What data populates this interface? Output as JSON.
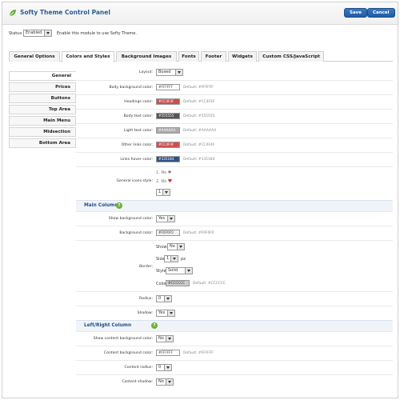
{
  "header": {
    "title": "Softy Theme Control Panel",
    "save_label": "Save",
    "cancel_label": "Cancel"
  },
  "status": {
    "label": "Status:",
    "value": "Enabled",
    "description": "Enable this module to use Softy Theme."
  },
  "tabs": [
    {
      "label": "General Options"
    },
    {
      "label": "Colors and Styles"
    },
    {
      "label": "Background Images"
    },
    {
      "label": "Fonts"
    },
    {
      "label": "Footer"
    },
    {
      "label": "Widgets"
    },
    {
      "label": "Custom CSS/JavaScript"
    }
  ],
  "sidebar": [
    {
      "label": "General"
    },
    {
      "label": "Prices"
    },
    {
      "label": "Buttons"
    },
    {
      "label": "Top Area"
    },
    {
      "label": "Main Menu"
    },
    {
      "label": "Midsection"
    },
    {
      "label": "Bottom Area"
    }
  ],
  "general": {
    "layout": {
      "label": "Layout:",
      "value": "Boxed"
    },
    "colors": [
      {
        "label": "Body background color:",
        "value": "#FFFFFF",
        "default": "Default: #FFFFFF",
        "swatch": "#FFFFFF"
      },
      {
        "label": "Headings color:",
        "value": "#CC4F4F",
        "default": "Default: #CC4F4F",
        "swatch": "#CC4F4F"
      },
      {
        "label": "Body text color:",
        "value": "#555555",
        "default": "Default: #555555",
        "swatch": "#555555"
      },
      {
        "label": "Light text color:",
        "value": "#AAAAAA",
        "default": "Default: #AAAAAA",
        "swatch": "#AAAAAA"
      },
      {
        "label": "Other links color:",
        "value": "#CC4F4F",
        "default": "Default: #CC4F4F",
        "swatch": "#CC4F4F"
      },
      {
        "label": "Links hover color:",
        "value": "#335184",
        "default": "Default: #335184",
        "swatch": "#335184"
      }
    ],
    "icons_style": {
      "label": "General icons style:",
      "opt1": "1. No",
      "opt2": "2. No",
      "value": "1"
    }
  },
  "main_column": {
    "title": "Main Column",
    "show_bg": {
      "label": "Show background color:",
      "value": "Yes"
    },
    "bg_color": {
      "label": "Background color:",
      "value": "#F0F0F0",
      "default": "Default: #F0F0F0"
    },
    "border": {
      "label": "Border:",
      "show": {
        "label": "Show:",
        "value": "No"
      },
      "size": {
        "label": "Size:",
        "value": "1",
        "unit": "px"
      },
      "style": {
        "label": "Style:",
        "value": "Solid"
      },
      "color": {
        "label": "Color:",
        "value": "#CCCCCC",
        "default": "Default: #CCCCCC"
      }
    },
    "radius": {
      "label": "Radius:",
      "value": "0"
    },
    "shadow": {
      "label": "Shadow:",
      "value": "Yes"
    }
  },
  "lr_column": {
    "title": "Left/Right Column",
    "show_content_bg": {
      "label": "Show content background color:",
      "value": "No"
    },
    "content_bg": {
      "label": "Content background color:",
      "value": "#FFFFFF",
      "default": "Default: #FFFFFF"
    },
    "content_radius": {
      "label": "Content radius:",
      "value": "0"
    },
    "content_shadow": {
      "label": "Content shadow:",
      "value": "No"
    }
  },
  "colors": {
    "accent": "#2a5d96",
    "button": "#1f5aa8",
    "help": "#6fb03a"
  }
}
